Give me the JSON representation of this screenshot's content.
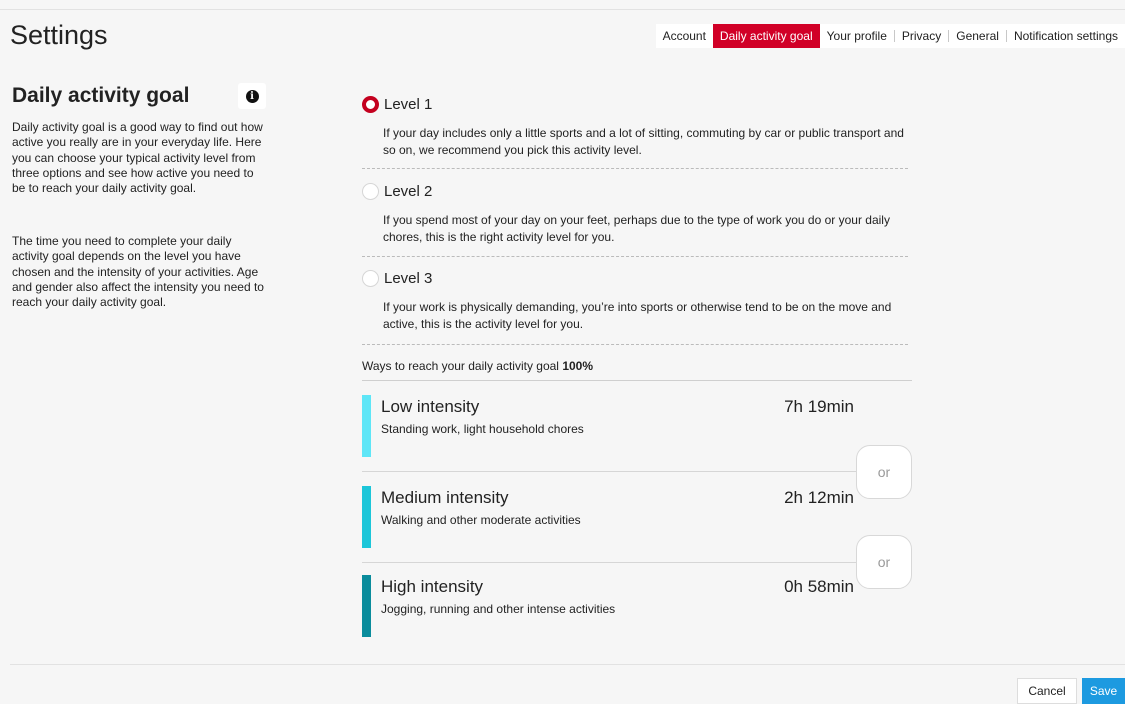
{
  "page": {
    "title": "Settings"
  },
  "tabs": [
    {
      "label": "Account",
      "active": false
    },
    {
      "label": "Daily activity goal",
      "active": true
    },
    {
      "label": "Your profile",
      "active": false
    },
    {
      "label": "Privacy",
      "active": false
    },
    {
      "label": "General",
      "active": false
    },
    {
      "label": "Notification settings",
      "active": false
    }
  ],
  "sidebar": {
    "title": "Daily activity goal",
    "info_icon": "info-icon",
    "paragraphs": [
      "Daily activity goal is a good way to find out how active you really are in your everyday life. Here you can choose your typical activity level from three options and see how active you need to be to reach your daily activity goal.",
      "The time you need to complete your daily activity goal depends on the level you have chosen and the intensity of your activities. Age and gender also affect the intensity you need to reach your daily activity goal."
    ]
  },
  "levels": [
    {
      "label": "Level 1",
      "selected": true,
      "description": "If your day includes only a little sports and a lot of sitting, commuting by car or public transport and so on, we recommend you pick this activity level."
    },
    {
      "label": "Level 2",
      "selected": false,
      "description": "If you spend most of your day on your feet, perhaps due to the type of work you do or your daily chores, this is the right activity level for you."
    },
    {
      "label": "Level 3",
      "selected": false,
      "description": "If your work is physically demanding, you’re into sports or otherwise tend to be on the move and active, this is the activity level for you."
    }
  ],
  "ways": {
    "label": "Ways to reach your daily activity goal",
    "percent": "100%"
  },
  "intensities": [
    {
      "title": "Low intensity",
      "subtitle": "Standing work, light household chores",
      "time": "7h 19min",
      "color": "#5ee6f7"
    },
    {
      "title": "Medium intensity",
      "subtitle": "Walking and other moderate activities",
      "time": "2h 12min",
      "color": "#1cc6d9"
    },
    {
      "title": "High intensity",
      "subtitle": "Jogging, running and other intense activities",
      "time": "0h 58min",
      "color": "#0a8c9c"
    }
  ],
  "or_label": "or",
  "footer": {
    "cancel_label": "Cancel",
    "save_label": "Save"
  },
  "colors": {
    "accent_red": "#d10027",
    "save_blue": "#1d9ae0"
  }
}
